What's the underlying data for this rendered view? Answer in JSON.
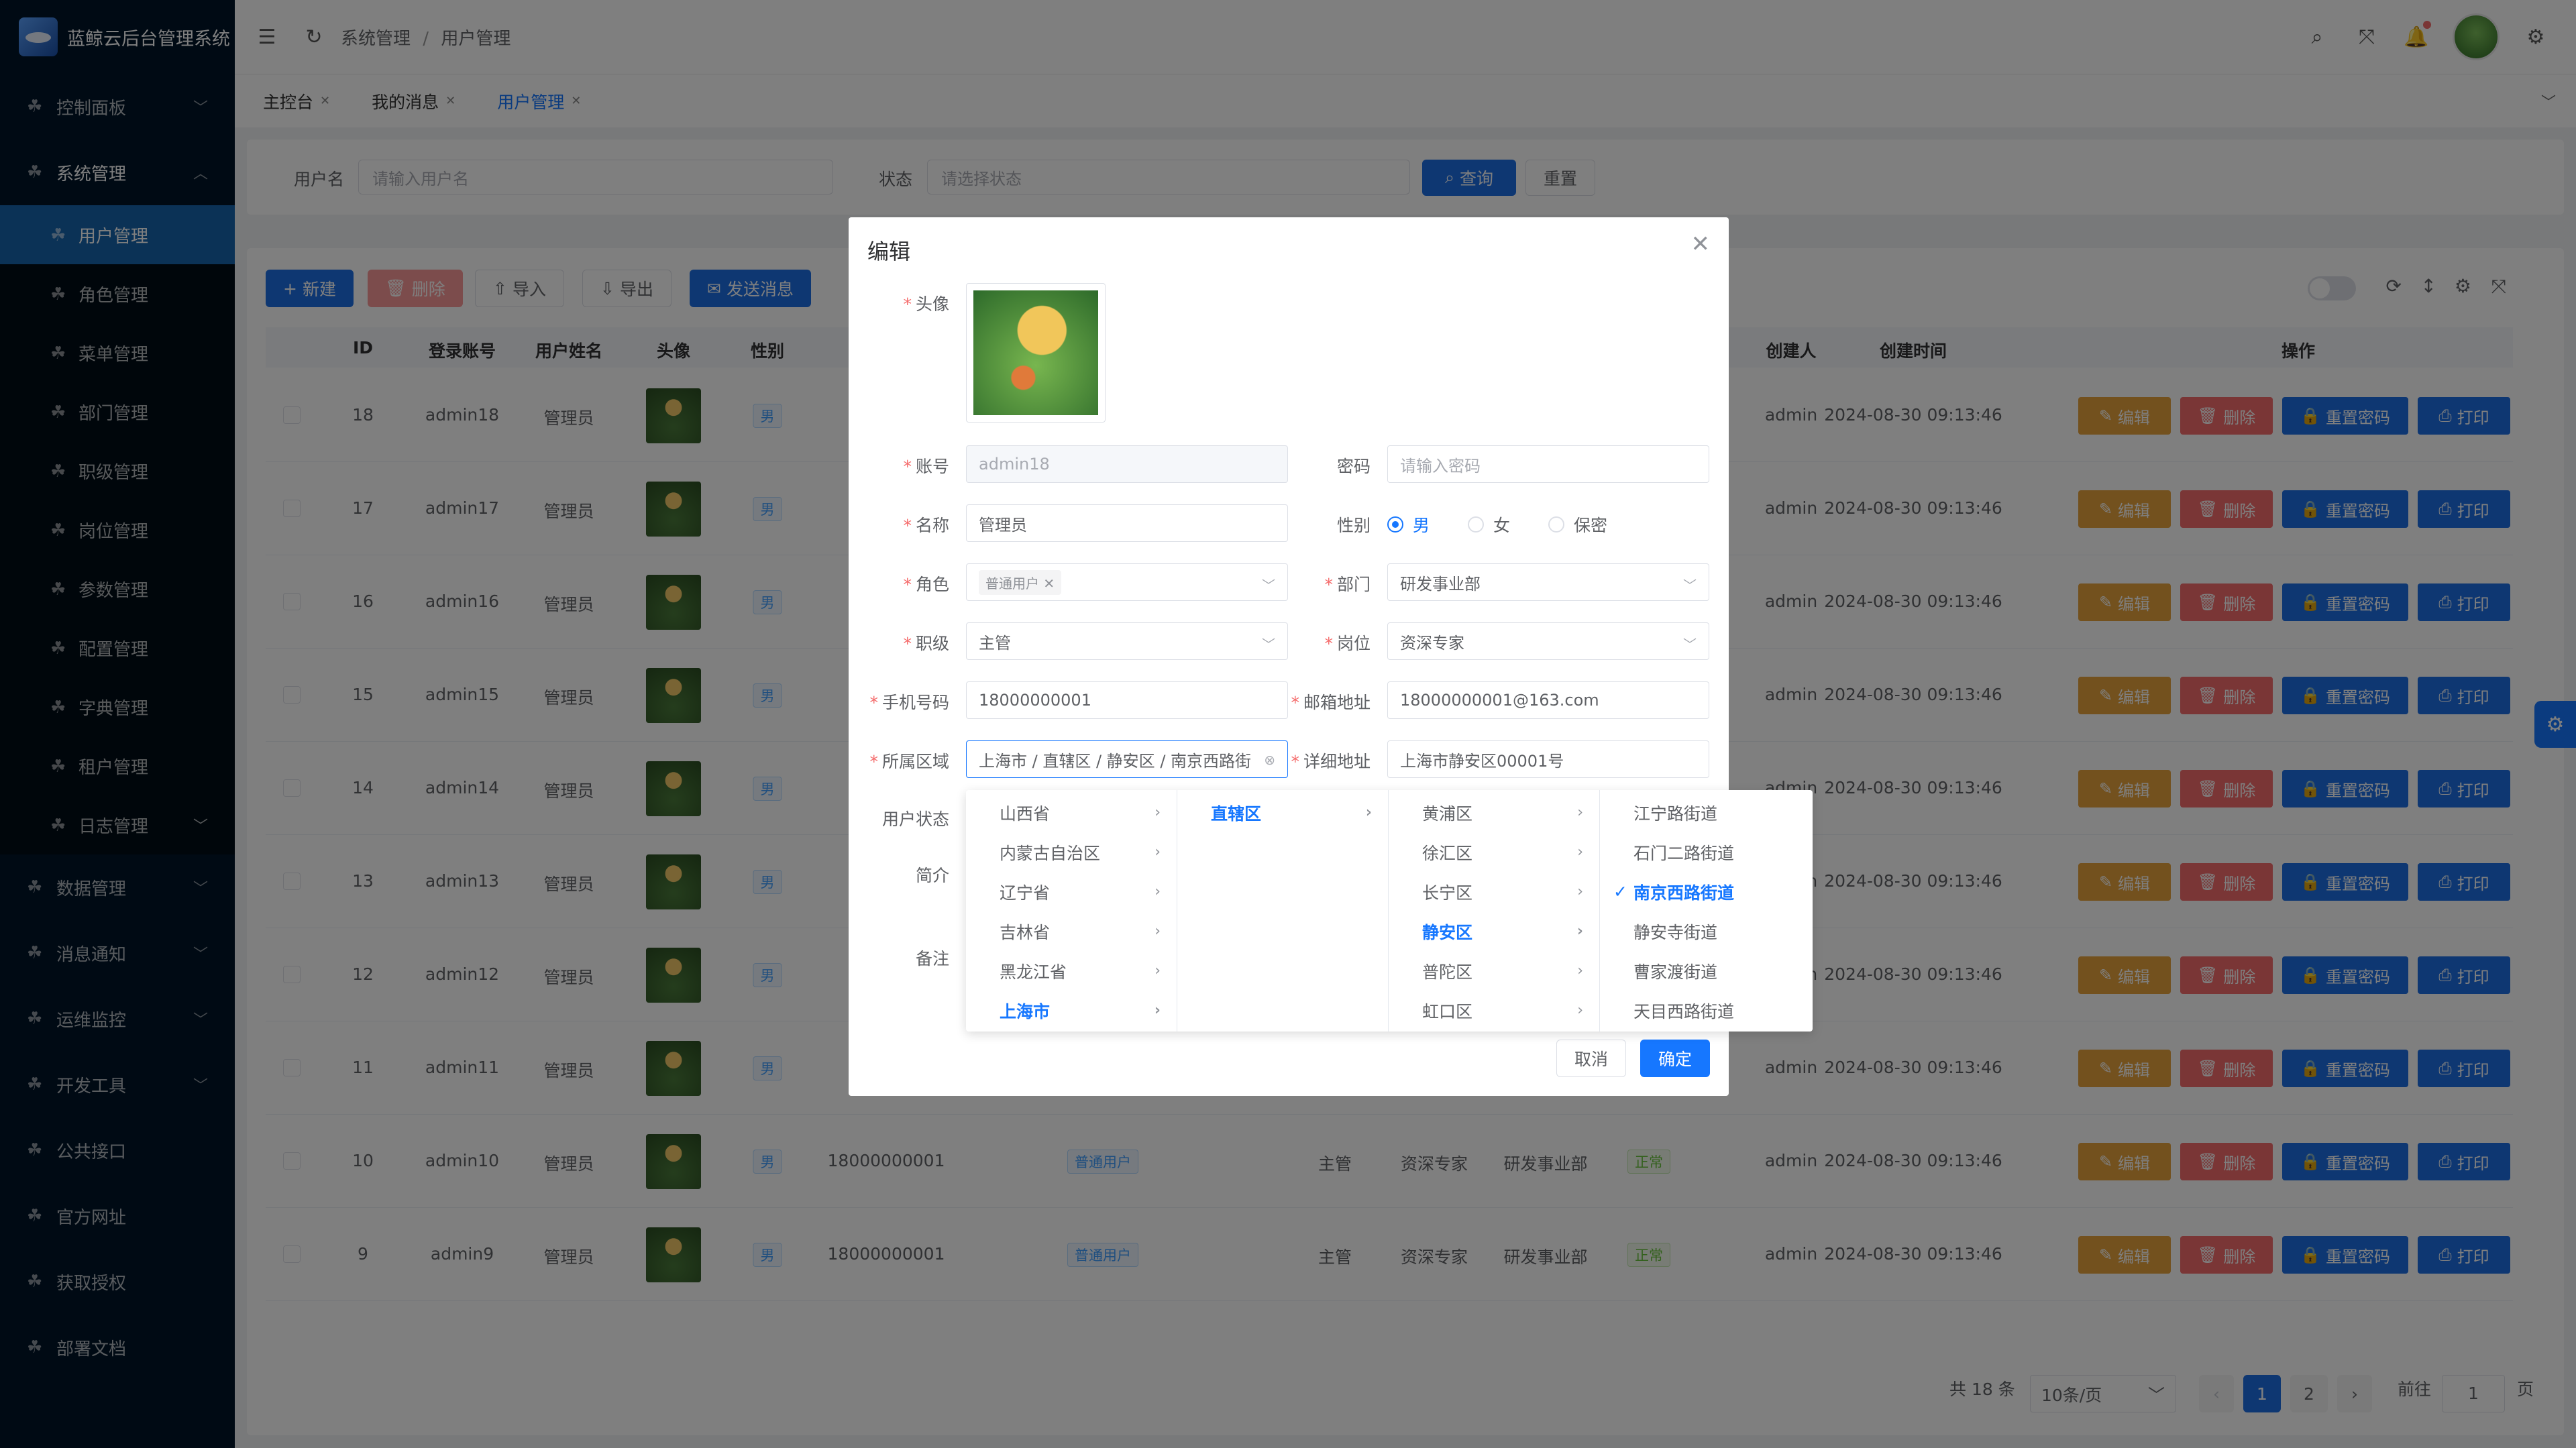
{
  "app": {
    "title": "蓝鲸云后台管理系统"
  },
  "sidebar": {
    "items": [
      {
        "label": "控制面板",
        "expanded": false
      },
      {
        "label": "系统管理",
        "expanded": true
      }
    ],
    "sub_items": [
      "用户管理",
      "角色管理",
      "菜单管理",
      "部门管理",
      "职级管理",
      "岗位管理",
      "参数管理",
      "配置管理",
      "字典管理",
      "租户管理",
      "日志管理"
    ],
    "bottom_items": [
      "数据管理",
      "消息通知",
      "运维监控",
      "开发工具",
      "公共接口",
      "官方网址",
      "获取授权",
      "部署文档"
    ]
  },
  "header": {
    "breadcrumb_1": "系统管理",
    "breadcrumb_sep": "/",
    "breadcrumb_2": "用户管理"
  },
  "tabs": [
    {
      "label": "主控台",
      "active": false
    },
    {
      "label": "我的消息",
      "active": false
    },
    {
      "label": "用户管理",
      "active": true
    }
  ],
  "search": {
    "username_label": "用户名",
    "username_placeholder": "请输入用户名",
    "status_label": "状态",
    "status_placeholder": "请选择状态",
    "query_label": "查询",
    "reset_label": "重置"
  },
  "toolbar": {
    "new": "新建",
    "delete": "删除",
    "import": "导入",
    "export": "导出",
    "send": "发送消息"
  },
  "table": {
    "headers": {
      "id": "ID",
      "account": "登录账号",
      "name": "用户姓名",
      "avatar": "头像",
      "gender": "性别",
      "creator": "创建人",
      "created": "创建时间",
      "actions": "操作"
    },
    "rows": [
      {
        "id": "18",
        "account": "admin18",
        "name": "管理员",
        "gender": "男",
        "creator": "admin",
        "created": "2024-08-30 09:13:46"
      },
      {
        "id": "17",
        "account": "admin17",
        "name": "管理员",
        "gender": "男",
        "creator": "admin",
        "created": "2024-08-30 09:13:46"
      },
      {
        "id": "16",
        "account": "admin16",
        "name": "管理员",
        "gender": "男",
        "creator": "admin",
        "created": "2024-08-30 09:13:46"
      },
      {
        "id": "15",
        "account": "admin15",
        "name": "管理员",
        "gender": "男",
        "creator": "admin",
        "created": "2024-08-30 09:13:46"
      },
      {
        "id": "14",
        "account": "admin14",
        "name": "管理员",
        "gender": "男",
        "creator": "admin",
        "created": "2024-08-30 09:13:46"
      },
      {
        "id": "13",
        "account": "admin13",
        "name": "管理员",
        "gender": "男",
        "creator": "admin",
        "created": "2024-08-30 09:13:46"
      },
      {
        "id": "12",
        "account": "admin12",
        "name": "管理员",
        "gender": "男",
        "creator": "admin",
        "created": "2024-08-30 09:13:46"
      },
      {
        "id": "11",
        "account": "admin11",
        "name": "管理员",
        "gender": "男",
        "creator": "admin",
        "created": "2024-08-30 09:13:46"
      },
      {
        "id": "10",
        "account": "admin10",
        "name": "管理员",
        "gender": "男",
        "phone": "18000000001",
        "role": "普通用户",
        "level": "主管",
        "post": "资深专家",
        "dept": "研发事业部",
        "status": "正常",
        "creator": "admin",
        "created": "2024-08-30 09:13:46"
      },
      {
        "id": "9",
        "account": "admin9",
        "name": "管理员",
        "gender": "男",
        "phone": "18000000001",
        "role": "普通用户",
        "level": "主管",
        "post": "资深专家",
        "dept": "研发事业部",
        "status": "正常",
        "creator": "admin",
        "created": "2024-08-30 09:13:46"
      }
    ],
    "actions": {
      "edit": "编辑",
      "delete": "删除",
      "reset": "重置密码",
      "print": "打印"
    }
  },
  "pagination": {
    "total": "共 18 条",
    "page_size": "10条/页",
    "pages": [
      "1",
      "2"
    ],
    "current": "1",
    "goto_label": "前往",
    "goto_value": "1",
    "page_unit": "页"
  },
  "dialog": {
    "title": "编辑",
    "avatar_label": "头像",
    "account_label": "账号",
    "account_value": "admin18",
    "password_label": "密码",
    "password_placeholder": "请输入密码",
    "name_label": "名称",
    "name_value": "管理员",
    "gender_label": "性别",
    "gender_options": [
      "男",
      "女",
      "保密"
    ],
    "gender_selected": "男",
    "role_label": "角色",
    "role_tag": "普通用户",
    "dept_label": "部门",
    "dept_value": "研发事业部",
    "level_label": "职级",
    "level_value": "主管",
    "post_label": "岗位",
    "post_value": "资深专家",
    "phone_label": "手机号码",
    "phone_value": "18000000001",
    "email_label": "邮箱地址",
    "email_value": "18000000001@163.com",
    "region_label": "所属区域",
    "region_value": "上海市 / 直辖区 / 静安区 / 南京西路街",
    "address_label": "详细地址",
    "address_value": "上海市静安区00001号",
    "status_label": "用户状态",
    "intro_label": "简介",
    "remark_label": "备注",
    "cancel": "取消",
    "confirm": "确定"
  },
  "cascader": {
    "col1": [
      "山西省",
      "内蒙古自治区",
      "辽宁省",
      "吉林省",
      "黑龙江省",
      "上海市"
    ],
    "col1_selected": "上海市",
    "col2": [
      "直辖区"
    ],
    "col2_selected": "直辖区",
    "col3": [
      "黄浦区",
      "徐汇区",
      "长宁区",
      "静安区",
      "普陀区",
      "虹口区"
    ],
    "col3_selected": "静安区",
    "col4": [
      "江宁路街道",
      "石门二路街道",
      "南京西路街道",
      "静安寺街道",
      "曹家渡街道",
      "天目西路街道"
    ],
    "col4_selected": "南京西路街道"
  },
  "colors": {
    "primary": "#1677ff",
    "sidebar": "#001529",
    "danger": "#f56c6c",
    "warning": "#e6a23c"
  }
}
